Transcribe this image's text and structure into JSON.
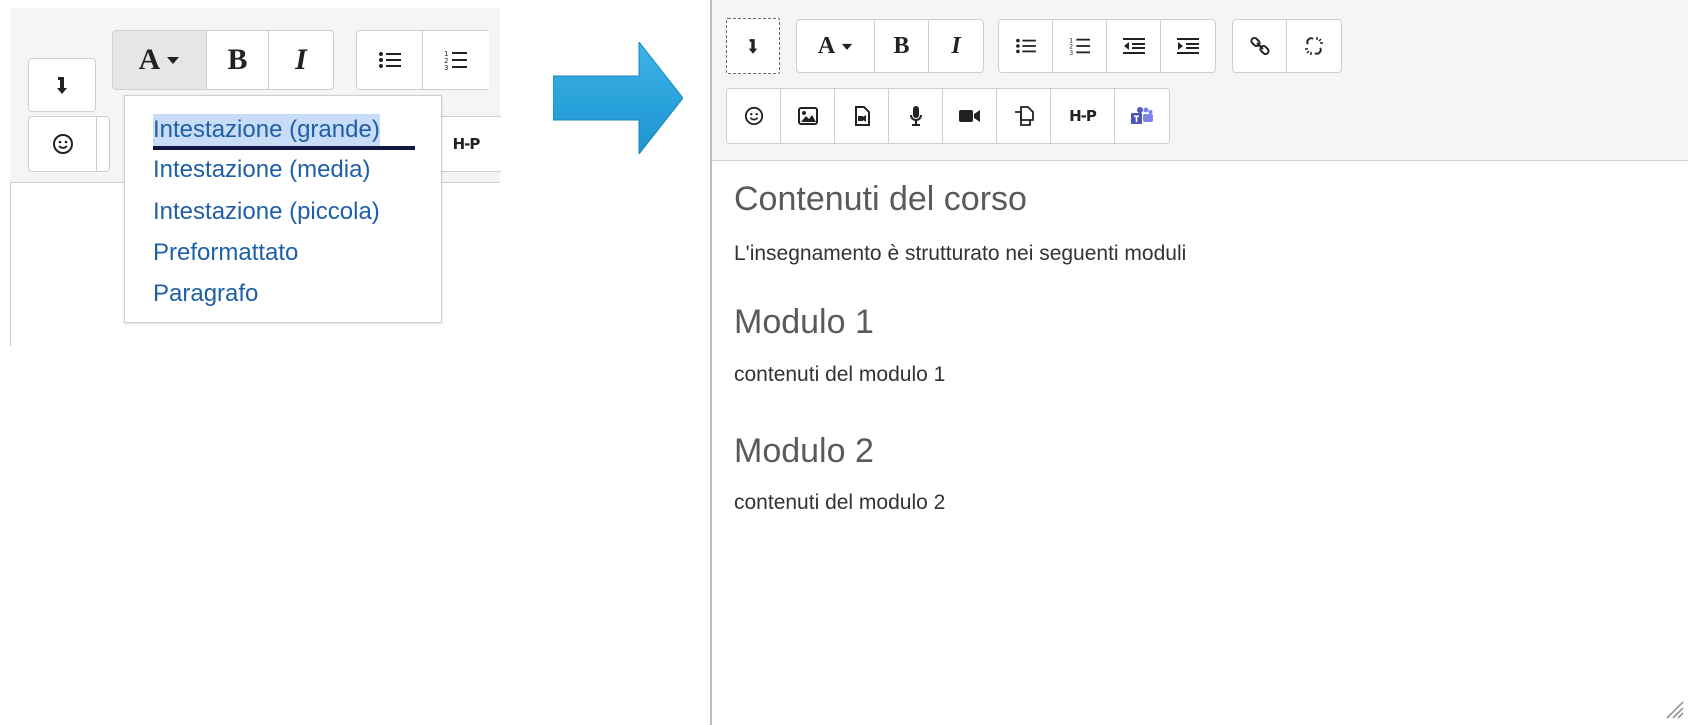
{
  "left_panel": {
    "row1_labels": {
      "bold": "B",
      "italic": "I",
      "font": "A"
    },
    "hp_label": "H-P",
    "dropdown": {
      "items": [
        "Intestazione (grande)",
        "Intestazione (media)",
        "Intestazione (piccola)",
        "Preformattato",
        "Paragrafo"
      ]
    }
  },
  "right_panel": {
    "row1_labels": {
      "bold": "B",
      "italic": "I",
      "font": "A"
    },
    "hp_label": "H-P",
    "content": {
      "heading1": "Contenuti del corso",
      "para1": "L'insegnamento è strutturato nei seguenti moduli",
      "heading2": "Modulo 1",
      "para2": "contenuti del modulo 1",
      "heading3": "Modulo 2",
      "para3": "contenuti del modulo 2"
    }
  },
  "colors": {
    "arrow": "#29a3dc",
    "link": "#1f5fa8",
    "selection": "#c8dcf5"
  }
}
